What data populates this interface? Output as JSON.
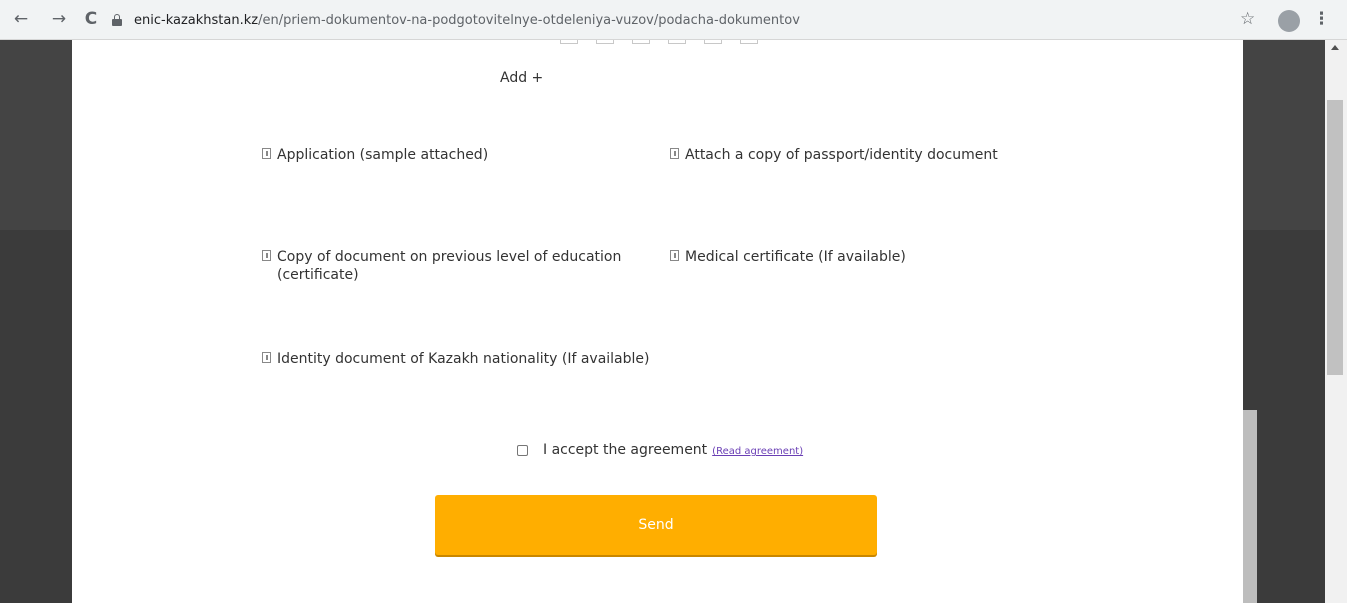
{
  "browser": {
    "back_glyph": "←",
    "forward_glyph": "→",
    "reload_glyph": "C",
    "url_domain": "enic-kazakhstan.kz",
    "url_path": "/en/priem-dokumentov-na-podgotovitelnye-otdeleniya-vuzov/podacha-dokumentov",
    "star_glyph": "☆",
    "menu_glyph": "⋮"
  },
  "form": {
    "add_label": "Add +",
    "documents": [
      {
        "label": "Application (sample attached)"
      },
      {
        "label": "Attach a copy of passport/identity document"
      },
      {
        "label": "Copy of document on previous level of education (certificate)"
      },
      {
        "label": "Medical certificate (If available)"
      },
      {
        "label": "Identity document of Kazakh nationality (If available)"
      }
    ],
    "agreement_label": "I accept the agreement",
    "agreement_link": "(Read agreement)",
    "send_label": "Send"
  },
  "colors": {
    "send_button": "#ffae00",
    "link": "#6a3fb5",
    "page_background": "#ffffff",
    "surround": "#3a3a3a"
  }
}
